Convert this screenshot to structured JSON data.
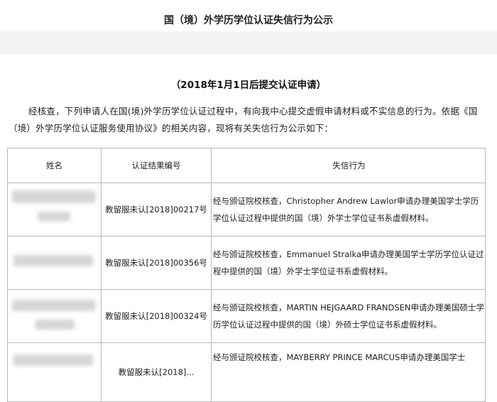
{
  "header": {
    "title": "国（境）外学历学位认证失信行为公示"
  },
  "section": {
    "subtitle": "（2018年1月1日后提交认证申请）",
    "intro": "经核查，下列申请人在国(境)外学历学位认证过程中，有向我中心提交虚假申请材料或不实信息的行为。依据《国（境）外学历学位认证服务使用协议》的相关内容，现将有关失信行为公示如下："
  },
  "table": {
    "headers": [
      "姓名",
      "认证结果编号",
      "失信行为"
    ],
    "rows": [
      {
        "name": "",
        "code": "教留服未认[2018]00217号",
        "desc": "经与颁证院校核查，Christopher Andrew Lawlor申请办理美国学士学历学位认证过程中提供的国（境）外学士学位证书系虚假材料。"
      },
      {
        "name": "",
        "code": "教留服未认[2018]00356号",
        "desc": "经与颁证院校核查，Emmanuel Stralka申请办理美国学士学历学位认证过程中提供的国（境）外学士学位证书系虚假材料。"
      },
      {
        "name": "",
        "code": "教留服未认[2018]00324号",
        "desc": "经与颁证院校核查，MARTIN HEJGAARD FRANDSEN申请办理美国硕士学历学位认证过程中提供的国（境）外硕士学位证书系虚假材料。"
      },
      {
        "name": "",
        "code": "教留服未认[2018]...",
        "desc": "经与颁证院校核查，MAYBERRY PRINCE MARCUS申请办理美国学士"
      }
    ]
  }
}
